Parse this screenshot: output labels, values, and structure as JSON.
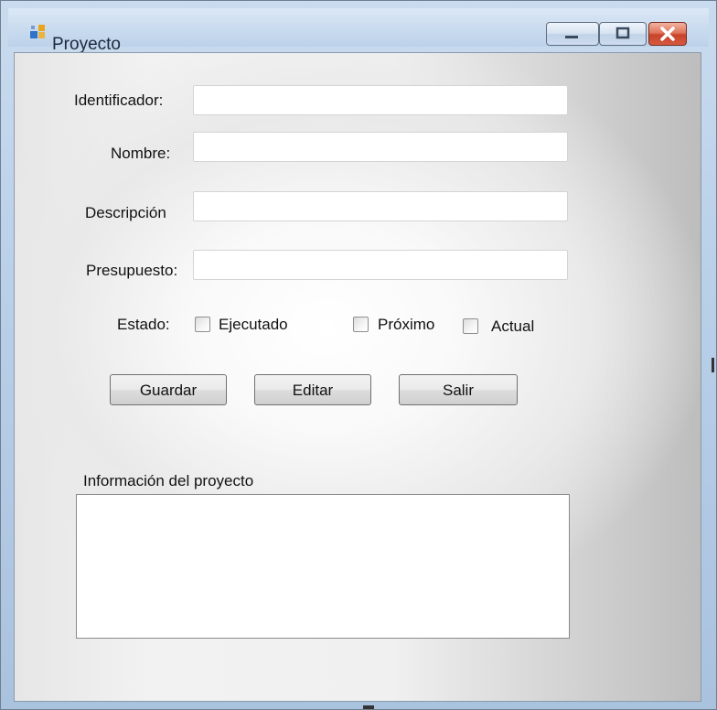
{
  "window": {
    "title": "Proyecto",
    "app_icon": "windows-form-icon",
    "controls": [
      "minimize-icon",
      "maximize-icon",
      "close-icon"
    ],
    "colors": {
      "close_button": "#d55a3f",
      "frame": "#bcd2ea"
    }
  },
  "form": {
    "identificador_label": "Identificador:",
    "identificador_value": "",
    "nombre_label": "Nombre:",
    "nombre_value": "",
    "descripcion_label": "Descripción",
    "descripcion_value": "",
    "presupuesto_label": "Presupuesto:",
    "presupuesto_value": "",
    "estado_label": "Estado:",
    "estado_options": [
      {
        "label": "Ejecutado",
        "checked": false
      },
      {
        "label": "Próximo",
        "checked": false
      },
      {
        "label": "Actual",
        "checked": false
      }
    ]
  },
  "buttons": {
    "guardar": "Guardar",
    "editar": "Editar",
    "salir": "Salir"
  },
  "info": {
    "label": "Información del proyecto",
    "value": ""
  }
}
